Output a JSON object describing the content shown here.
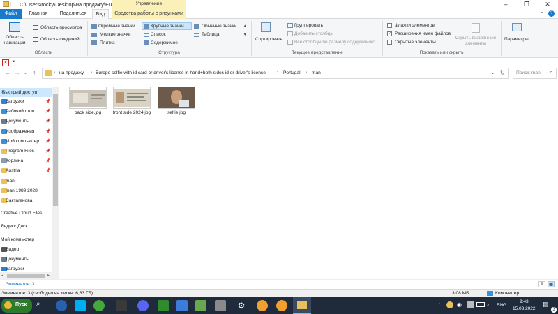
{
  "window": {
    "title": "C:\\Users\\rocky\\Desktop\\на продажу\\Europe...",
    "context_group": "Управление",
    "minimize": "–",
    "maximize": "❐",
    "close": "✕"
  },
  "tabs": {
    "file": "Файл",
    "home": "Главная",
    "share": "Поделиться",
    "view": "Вид",
    "picture_tools": "Средства работы с рисунками"
  },
  "ribbon": {
    "panes": {
      "nav_pane": "Область навигации",
      "preview_pane": "Область просмотра",
      "details_pane": "Область сведений",
      "label": "Области"
    },
    "layout": {
      "extra_large": "Огромные значки",
      "large": "Крупные значки",
      "medium": "Обычные значки",
      "small": "Мелкие значки",
      "list": "Список",
      "details": "Таблица",
      "tiles": "Плитка",
      "content": "Содержимое",
      "label": "Структура"
    },
    "current_view": {
      "sort": "Сортировать",
      "group": "Группировать",
      "add_columns": "Добавить столбцы",
      "size_columns": "Все столбцы по размеру содержимого",
      "label": "Текущее представление"
    },
    "show_hide": {
      "item_checkboxes": "Флажки элементов",
      "file_extensions": "Расширения имен файлов",
      "hidden_items": "Скрытые элементы",
      "hide_selected": "Скрыть выбранные элементы",
      "label": "Показать или скрыть"
    },
    "options": "Параметры"
  },
  "address": {
    "crumbs": [
      "на продажу",
      "Europe selfie with id card or driver's license in hand+both sides id or driver's license",
      "Portugal",
      "man"
    ],
    "search_placeholder": "Поиск: man"
  },
  "nav": {
    "quick_access": "Быстрый доступ",
    "items": [
      {
        "label": "Загрузки",
        "pinned": true,
        "color": "#2f7ed8"
      },
      {
        "label": "Рабочий стол",
        "pinned": true,
        "color": "#3a8fd9"
      },
      {
        "label": "Документы",
        "pinned": true,
        "color": "#6d7a8a"
      },
      {
        "label": "Изображения",
        "pinned": true,
        "color": "#3a8fd9"
      },
      {
        "label": "Мой компьютер",
        "pinned": true,
        "color": "#3a8fd9"
      },
      {
        "label": "Program Files",
        "pinned": true,
        "color": "#e8c15a"
      },
      {
        "label": "Корзина",
        "pinned": true,
        "color": "#8a9bb0"
      },
      {
        "label": "Austria",
        "pinned": true,
        "color": "#e8c15a"
      },
      {
        "label": "man",
        "pinned": false,
        "color": "#e8c15a"
      },
      {
        "label": "man 1989 2028",
        "pinned": false,
        "color": "#e8c15a"
      },
      {
        "label": "Сактаганова",
        "pinned": false,
        "color": "#e8c15a"
      }
    ],
    "creative_cloud": "Creative Cloud Files",
    "yandex": "Яндекс.Диск",
    "this_pc": "Мой компьютер",
    "pc_items": [
      {
        "label": "Видео",
        "color": "#555"
      },
      {
        "label": "Документы",
        "color": "#6d7a8a"
      },
      {
        "label": "Загрузки",
        "color": "#2f7ed8"
      }
    ]
  },
  "files": [
    {
      "name": "back side.jpg",
      "thumb_color": "#c9c2b6"
    },
    {
      "name": "front side 2024.jpg",
      "thumb_color": "#d8d3c2"
    },
    {
      "name": "selfie.jpg",
      "thumb_color": "#a5866d"
    }
  ],
  "status": {
    "count": "Элементов: 3",
    "disk_info": "Элементов: 3 (свободно на диске: 6,63 ГБ)",
    "size": "3,08 МБ",
    "computer": "Компьютер"
  },
  "taskbar": {
    "start": "Пуск",
    "lang": "ENG",
    "time": "9:43",
    "date": "15.03.2022",
    "notif_count": "3"
  }
}
